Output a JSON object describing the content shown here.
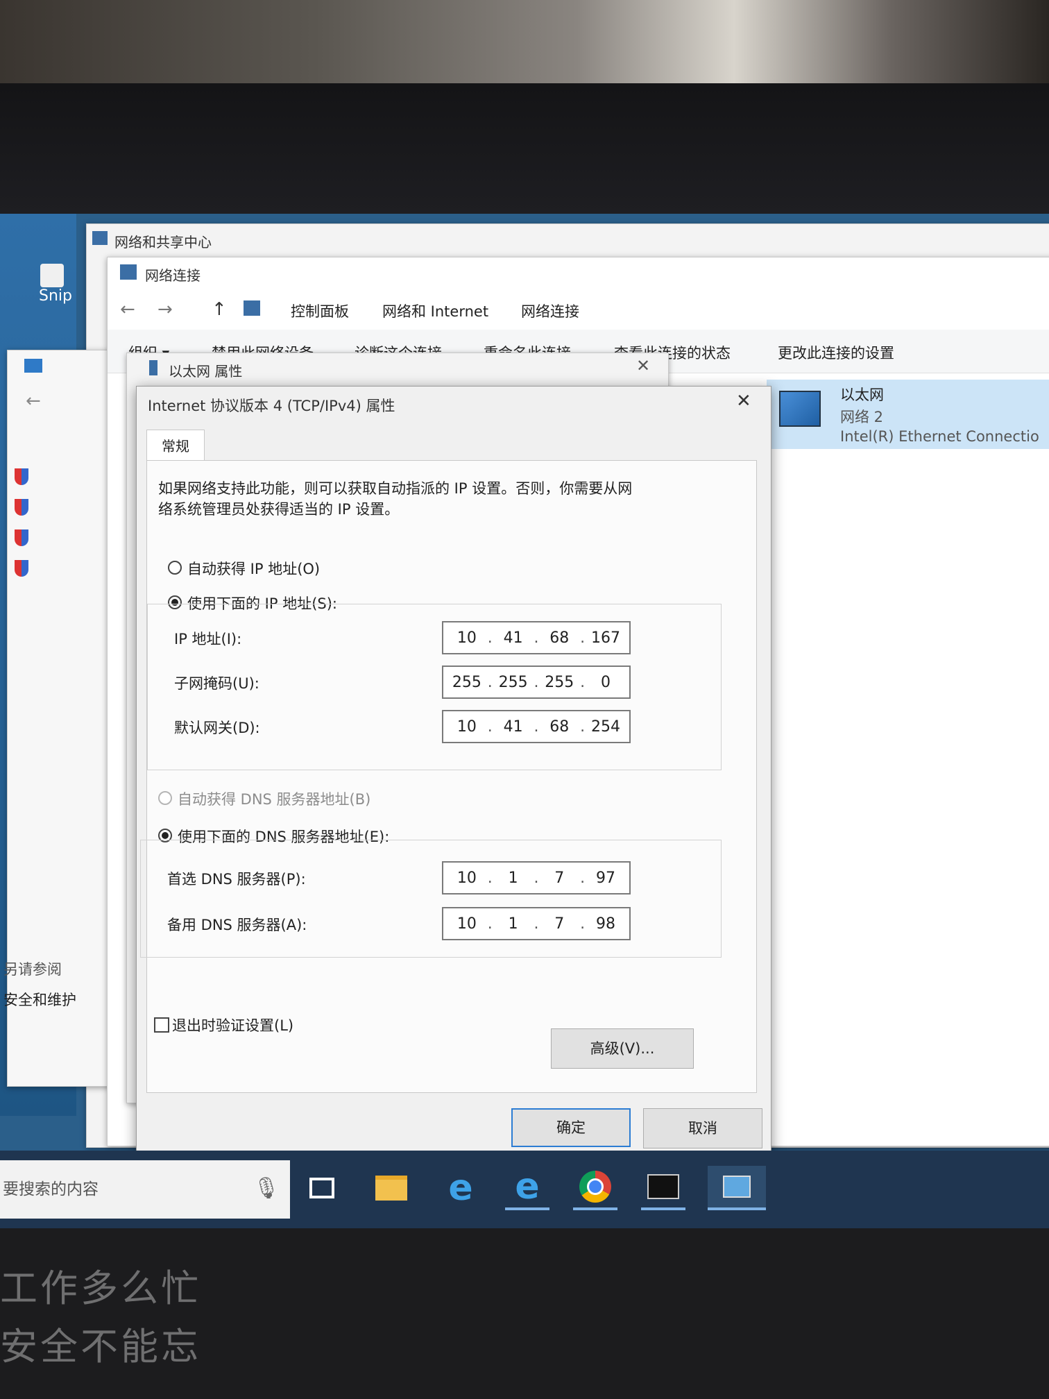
{
  "background_windows": {
    "network_center_title": "网络和共享中心",
    "network_connections_title": "网络连接",
    "breadcrumb": [
      "控制面板",
      "网络和 Internet",
      "网络连接"
    ],
    "toolbar": [
      "组织 ▾",
      "禁用此网络设备",
      "诊断这个连接",
      "重命名此连接",
      "查看此连接的状态",
      "更改此连接的设置"
    ],
    "adapter": {
      "name": "以太网",
      "network": "网络 2",
      "device": "Intel(R) Ethernet Connectio"
    },
    "ethernet_props_title": "以太网 属性",
    "left_panel_text": [
      "另请参阅",
      "安全和维护"
    ],
    "desktop_icon_label": "Snip"
  },
  "dialog": {
    "title": "Internet 协议版本 4 (TCP/IPv4) 属性",
    "tab": "常规",
    "intro": "如果网络支持此功能，则可以获取自动指派的 IP 设置。否则，你需要从网络系统管理员处获得适当的 IP 设置。",
    "intro_line1": "如果网络支持此功能，则可以获取自动指派的 IP 设置。否则，你需要从网",
    "intro_line2": "络系统管理员处获得适当的 IP 设置。",
    "auto_ip_label": "自动获得 IP 地址(O)",
    "manual_ip_label": "使用下面的 IP 地址(S):",
    "ip_mode": "manual",
    "ip_address_label": "IP 地址(I):",
    "ip_address": [
      "10",
      "41",
      "68",
      "167"
    ],
    "subnet_label": "子网掩码(U):",
    "subnet": [
      "255",
      "255",
      "255",
      "0"
    ],
    "gateway_label": "默认网关(D):",
    "gateway": [
      "10",
      "41",
      "68",
      "254"
    ],
    "auto_dns_label": "自动获得 DNS 服务器地址(B)",
    "manual_dns_label": "使用下面的 DNS 服务器地址(E):",
    "dns_mode": "manual",
    "preferred_dns_label": "首选 DNS 服务器(P):",
    "preferred_dns": [
      "10",
      "1",
      "7",
      "97"
    ],
    "alternate_dns_label": "备用 DNS 服务器(A):",
    "alternate_dns": [
      "10",
      "1",
      "7",
      "98"
    ],
    "validate_label": "退出时验证设置(L)",
    "validate_checked": false,
    "advanced_button": "高级(V)...",
    "ok_button": "确定",
    "cancel_button": "取消",
    "close_glyph": "✕"
  },
  "taskbar": {
    "search_placeholder": "要搜索的内容",
    "icons": [
      "microphone-icon",
      "task-view-icon",
      "file-explorer-icon",
      "ie-icon",
      "ie-icon",
      "chrome-icon",
      "cmd-icon",
      "control-panel-icon"
    ]
  },
  "wall_slogan": [
    "工作多么忙",
    "安全不能忘"
  ],
  "colors": {
    "accent": "#2b7cd3",
    "taskbar": "#1f3550",
    "dialog_bg": "#f0f0f0"
  }
}
